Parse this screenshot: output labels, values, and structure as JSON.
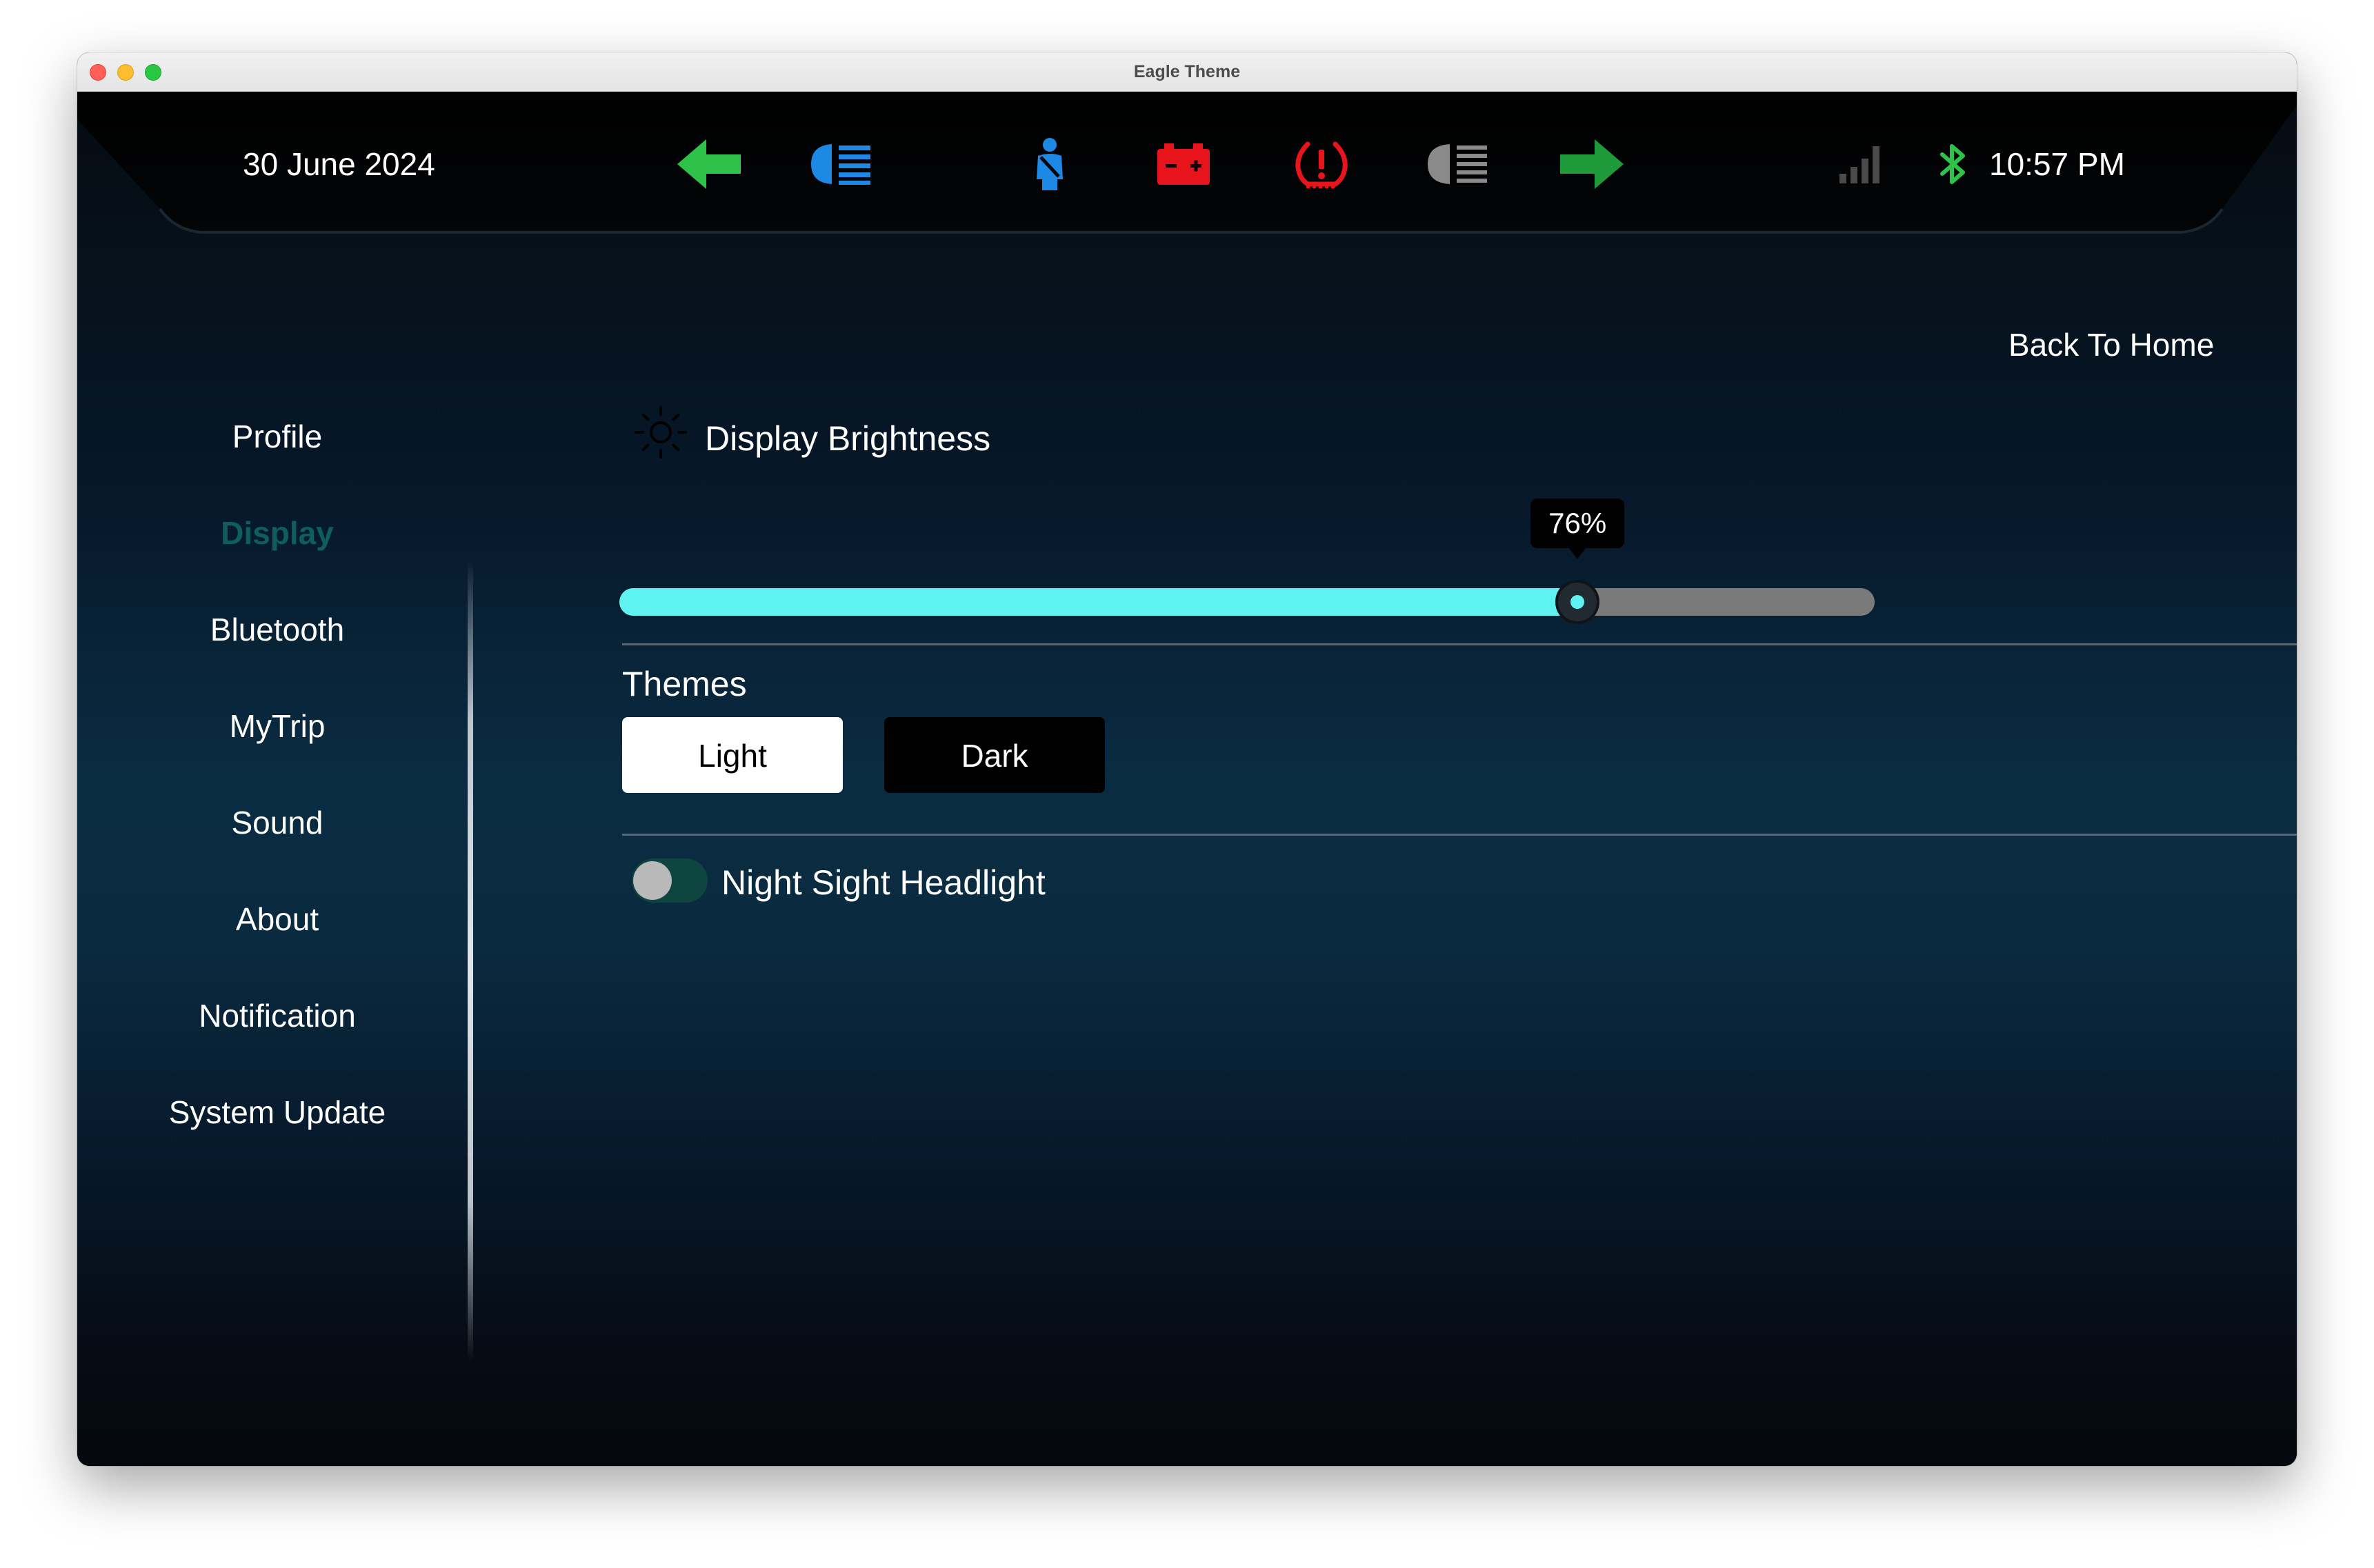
{
  "window": {
    "title": "Eagle Theme"
  },
  "status_bar": {
    "date": "30 June 2024",
    "time": "10:57 PM",
    "indicators": [
      {
        "icon": "left-turn-arrow-icon",
        "color": "#2ec24a"
      },
      {
        "icon": "high-beam-headlight-icon",
        "color": "#1e88e5"
      },
      {
        "icon": "seatbelt-warning-icon",
        "color": "#1e88e5"
      },
      {
        "icon": "battery-warning-icon",
        "color": "#e8141c"
      },
      {
        "icon": "tire-pressure-warning-icon",
        "color": "#e8141c"
      },
      {
        "icon": "low-beam-headlight-icon",
        "color": "#8a8a8a"
      },
      {
        "icon": "right-turn-arrow-icon",
        "color": "#1f9a3a"
      }
    ],
    "signal_icon": "cellular-signal-icon",
    "bluetooth_icon": "bluetooth-icon",
    "bluetooth_color": "#2ec24a"
  },
  "header": {
    "back_to_home": "Back To Home"
  },
  "sidebar": {
    "active_index": 1,
    "active_color": "#0f5d5c",
    "items": [
      {
        "label": "Profile"
      },
      {
        "label": "Display"
      },
      {
        "label": "Bluetooth"
      },
      {
        "label": "MyTrip"
      },
      {
        "label": "Sound"
      },
      {
        "label": "About"
      },
      {
        "label": "Notification"
      },
      {
        "label": "System Update"
      }
    ]
  },
  "brightness": {
    "title": "Display Brightness",
    "icon": "sun-icon",
    "value_percent": 76,
    "value_label": "76%",
    "accent_color": "#5ef3f0"
  },
  "themes": {
    "title": "Themes",
    "options": [
      "Light",
      "Dark"
    ],
    "selected": "Light"
  },
  "night_sight": {
    "label": "Night Sight Headlight",
    "enabled": false
  }
}
